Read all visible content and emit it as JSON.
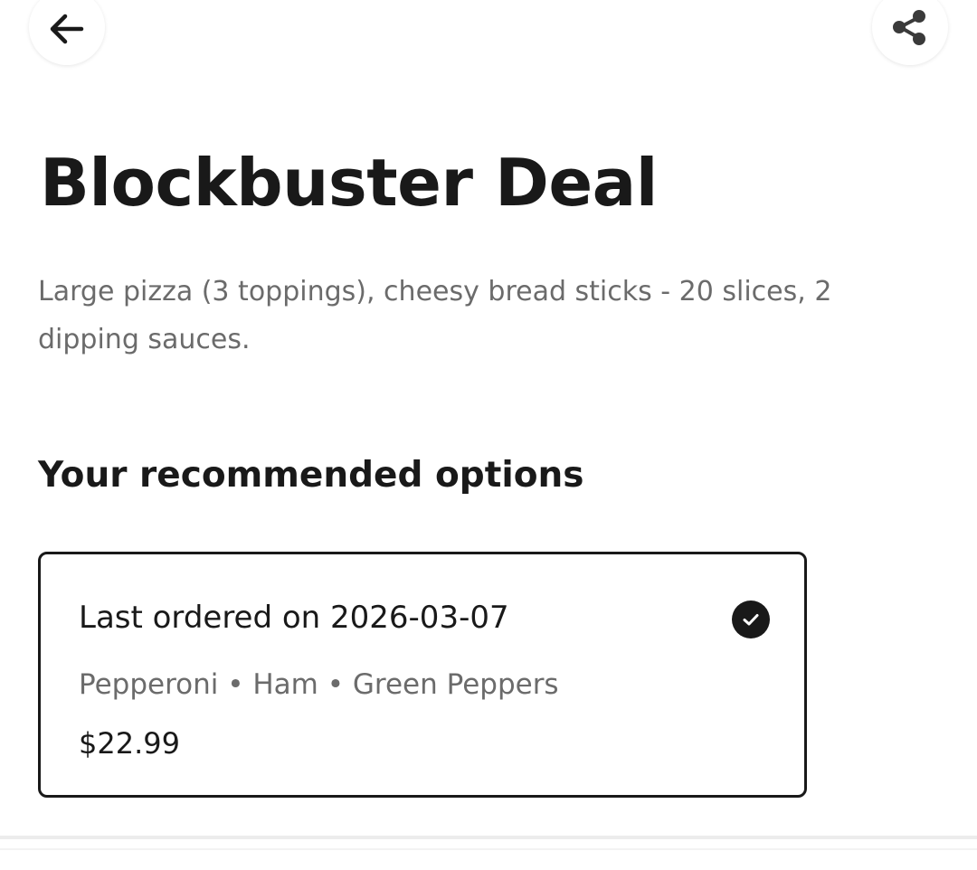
{
  "header": {
    "back_icon": "arrow-left-icon",
    "share_icon": "share-icon"
  },
  "item": {
    "title": "Blockbuster Deal",
    "description": "Large pizza (3 toppings), cheesy bread sticks - 20 slices, 2 dipping sauces."
  },
  "recommended": {
    "heading": "Your recommended options",
    "options": [
      {
        "title": "Last ordered on 2026-03-07",
        "toppings": "Pepperoni • Ham • Green Peppers",
        "price": "$22.99",
        "selected": true,
        "selected_icon": "check-circle-icon"
      }
    ]
  },
  "colors": {
    "text_primary": "#191919",
    "text_secondary": "#6b6b6b",
    "background": "#ffffff",
    "divider": "#ececec"
  }
}
